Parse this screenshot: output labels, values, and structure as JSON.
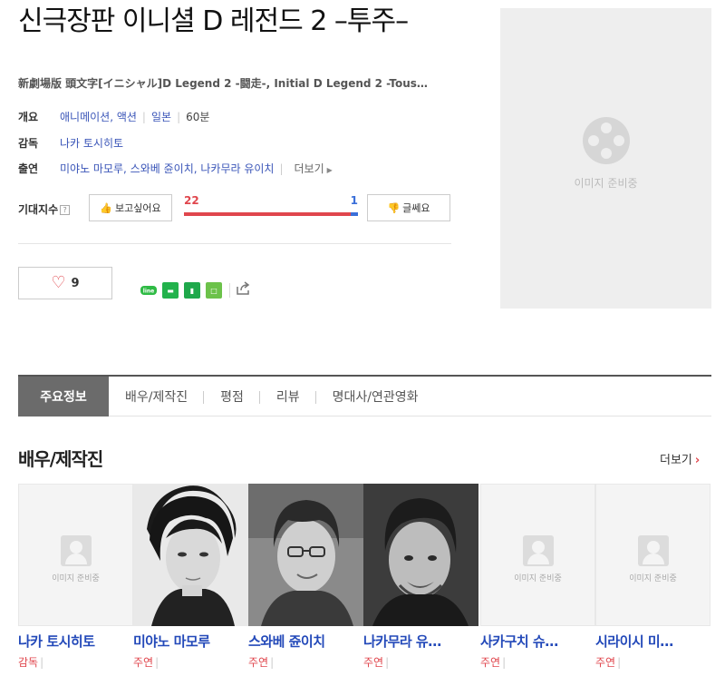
{
  "movie": {
    "title": "신극장판 이니셜 D 레전드 2 –투주–",
    "original_title": "新劇場版 頭文字[イニシャル]D Legend 2 -闘走-, Initial D Legend 2 -Tous…",
    "info_rows": {
      "overview_label": "개요",
      "genre": "애니메이션, 액션",
      "country": "일본",
      "runtime": "60분",
      "director_label": "감독",
      "director": "나카 토시히토",
      "cast_label": "출연",
      "cast": "미야노 마모루, 스와베 쥰이치, 나카무라 유이치",
      "more_label": "더보기"
    },
    "expectation": {
      "label": "기대지수",
      "help_icon": "?",
      "want_label": "보고싶어요",
      "want_count": "22",
      "no_label": "글쎄요",
      "no_count": "1",
      "want_ratio": 0.957
    },
    "like_count": "9",
    "poster_placeholder": "이미지 준비중"
  },
  "tabs": [
    "주요정보",
    "배우/제작진",
    "평점",
    "리뷰",
    "명대사/연관영화"
  ],
  "section": {
    "title": "배우/제작진",
    "more_label": "더보기"
  },
  "people": [
    {
      "name": "나카 토시히토",
      "role": "감독",
      "photo": "placeholder",
      "placeholder_text": "이미지 준비중"
    },
    {
      "name": "미야노 마모루",
      "role": "주연",
      "photo": "portrait"
    },
    {
      "name": "스와베 쥰이치",
      "role": "주연",
      "photo": "portrait"
    },
    {
      "name": "나카무라 유…",
      "role": "주연",
      "photo": "portrait"
    },
    {
      "name": "사카구치 슈…",
      "role": "주연",
      "photo": "placeholder",
      "placeholder_text": "이미지 준비중"
    },
    {
      "name": "시라이시 미…",
      "role": "주연",
      "photo": "placeholder",
      "placeholder_text": "이미지 준비중"
    }
  ],
  "colors": {
    "link": "#3a55b8",
    "want": "#e0464d",
    "no": "#3a6fd9",
    "tab_active": "#6b6b6b"
  }
}
